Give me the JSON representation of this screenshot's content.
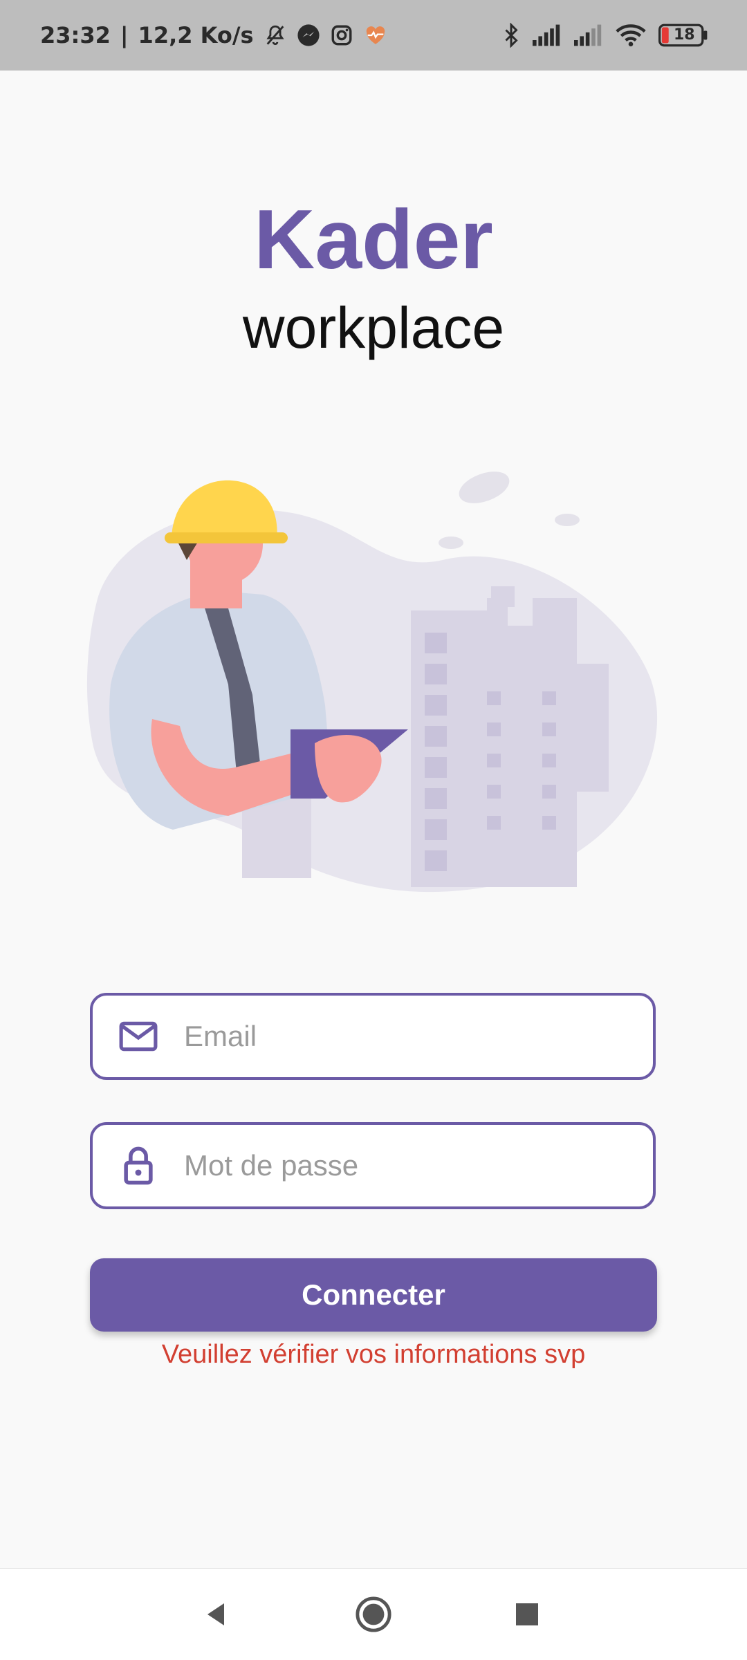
{
  "status_bar": {
    "time": "23:32",
    "network_speed": "12,2 Ko/s",
    "battery_level": "18",
    "icons": [
      "bell-off-icon",
      "messenger-icon",
      "instagram-icon",
      "health-icon",
      "bluetooth-icon",
      "signal-icon",
      "signal-icon",
      "wifi-icon",
      "battery-icon"
    ]
  },
  "header": {
    "brand": "Kader",
    "tagline": "workplace"
  },
  "form": {
    "email_placeholder": "Email",
    "password_placeholder": "Mot de passe",
    "submit_label": "Connecter",
    "error_message": "Veuillez vérifier vos informations svp"
  },
  "colors": {
    "accent": "#6b5aa6",
    "error": "#d23f31",
    "background": "#f9f9f9"
  },
  "nav_bar": {
    "icons": [
      "back-icon",
      "home-icon",
      "recents-icon"
    ]
  }
}
